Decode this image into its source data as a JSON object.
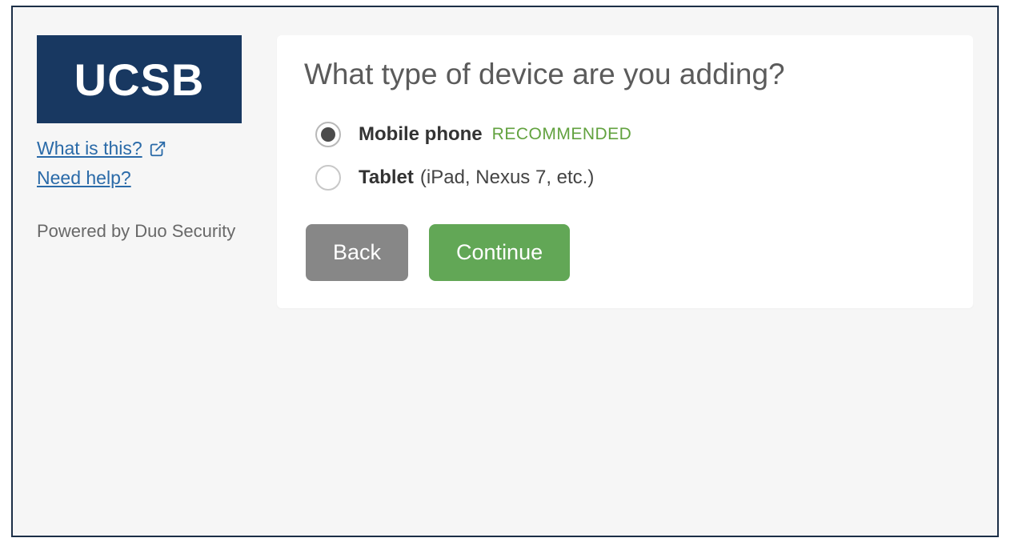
{
  "sidebar": {
    "logo_text": "UCSB",
    "links": {
      "what_is_this": "What is this?",
      "need_help": "Need help?"
    },
    "powered_by": "Powered by Duo Security"
  },
  "main": {
    "title": "What type of device are you adding?",
    "options": [
      {
        "label": "Mobile phone",
        "badge": "RECOMMENDED",
        "extra": "",
        "selected": true
      },
      {
        "label": "Tablet",
        "badge": "",
        "extra": "(iPad, Nexus 7, etc.)",
        "selected": false
      }
    ],
    "buttons": {
      "back": "Back",
      "continue": "Continue"
    }
  },
  "colors": {
    "logo_bg": "#183861",
    "link": "#2a6aa8",
    "badge": "#62a23f",
    "btn_back": "#878787",
    "btn_continue": "#62a756"
  }
}
